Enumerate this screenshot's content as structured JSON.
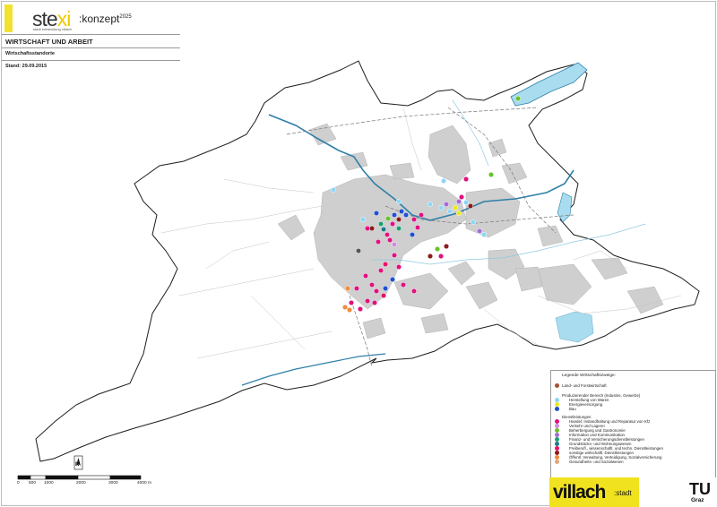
{
  "header": {
    "logo_main": "ste",
    "logo_x": "xi",
    "logo_sub": "stadt entwicklung villach",
    "logo_konzept": ":konzept",
    "logo_year": "2025",
    "title": "WIRTSCHAFT UND ARBEIT",
    "subtitle": "Wirtschaftsstandorte",
    "date": "Stand: 29.09.2015"
  },
  "legend": {
    "title": "Legende Wirtschaftszweige:",
    "items": [
      {
        "label": "Land- und Forstwirtschaft",
        "color": "#a0522d",
        "sub": false
      },
      {
        "label": "Produzierender Bereich (Industrie, Gewerbe)",
        "color": "",
        "sub": false
      },
      {
        "label": "Herstellung von Waren",
        "color": "#8ed6f5",
        "sub": true
      },
      {
        "label": "Energieversorgung",
        "color": "#e8e820",
        "sub": true
      },
      {
        "label": "Bau",
        "color": "#1f4fd1",
        "sub": true
      },
      {
        "label": "Dienstleistungen",
        "color": "",
        "sub": false
      },
      {
        "label": "Handel; Instandhaltung und Reparatur von Kfz",
        "color": "#e0117f",
        "sub": true
      },
      {
        "label": "Verkehr und Lagerei",
        "color": "#d08ad8",
        "sub": true
      },
      {
        "label": "Beherbergung und Gastronomie",
        "color": "#6ac12a",
        "sub": true
      },
      {
        "label": "Information und Kommunikation",
        "color": "#a36cd9",
        "sub": true
      },
      {
        "label": "Finanz- und Versicherungsdienstleistungen",
        "color": "#1f9e6e",
        "sub": true
      },
      {
        "label": "Grundstücks- und Wohnungswesen",
        "color": "#1a7a8c",
        "sub": true
      },
      {
        "label": "Freiberufl., wissenschaftl. und techn. Dienstleistungen",
        "color": "#e4136b",
        "sub": true
      },
      {
        "label": "sonstige wirtschaftl. Dienstleistungen",
        "color": "#8b1a1a",
        "sub": true
      },
      {
        "label": "Öffentl. Verwaltung, Verteidigung, Sozialversicherung",
        "color": "#f08c3c",
        "sub": true
      },
      {
        "label": "Gesundheits- und Sozialwesen",
        "color": "#e6a57a",
        "sub": true
      }
    ]
  },
  "scale": {
    "labels": [
      "0",
      "500",
      "1000",
      "2000",
      "3000",
      "4000 m"
    ],
    "north": "N"
  },
  "logos": {
    "villach": "villach",
    "villach_suffix": ":stadt",
    "tu": "TU",
    "tu_sub": "Graz"
  },
  "colors": {
    "accent_yellow": "#f1e21f",
    "urban_area": "#cfcfcf",
    "water": "#a9dcef",
    "river_line": "#2f7fa8",
    "tu_red": "#c0163c"
  }
}
